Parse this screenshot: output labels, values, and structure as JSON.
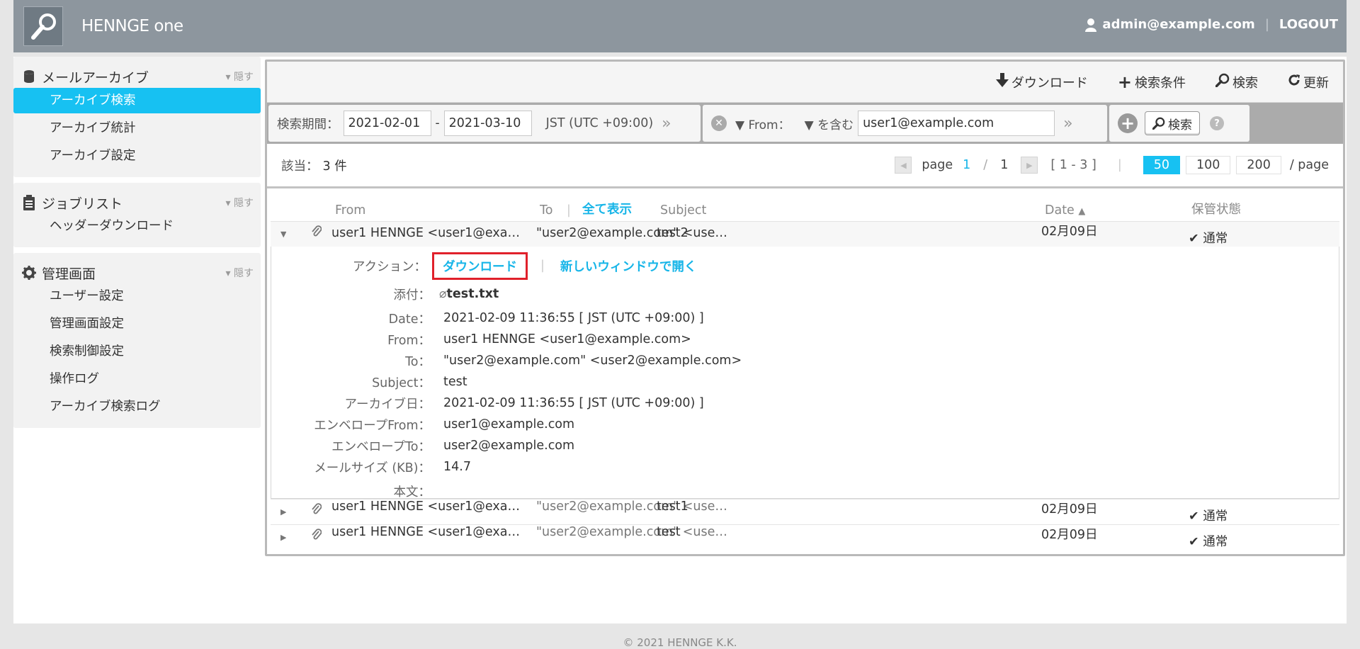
{
  "header": {
    "brand": "HENNGE one",
    "user": "admin@example.com",
    "logout": "LOGOUT"
  },
  "sidebar": {
    "sections": [
      {
        "title": "メールアーカイブ",
        "hide": "隠す",
        "items": [
          {
            "label": "アーカイブ検索",
            "active": true
          },
          {
            "label": "アーカイブ統計",
            "active": false
          },
          {
            "label": "アーカイブ設定",
            "active": false
          }
        ]
      },
      {
        "title": "ジョブリスト",
        "hide": "隠す",
        "items": [
          {
            "label": "ヘッダーダウンロード",
            "active": false
          }
        ]
      },
      {
        "title": "管理画面",
        "hide": "隠す",
        "items": [
          {
            "label": "ユーザー設定",
            "active": false
          },
          {
            "label": "管理画面設定",
            "active": false
          },
          {
            "label": "検索制御設定",
            "active": false
          },
          {
            "label": "操作ログ",
            "active": false
          },
          {
            "label": "アーカイブ検索ログ",
            "active": false
          }
        ]
      }
    ]
  },
  "toolbar": {
    "download": "ダウンロード",
    "conditions": "検索条件",
    "search": "検索",
    "refresh": "更新"
  },
  "search": {
    "period_label": "検索期間：",
    "date_from": "2021-02-01",
    "dash": "-",
    "date_to": "2021-03-10",
    "timezone": "JST (UTC +09:00)",
    "field": "From：",
    "operator": "を含む",
    "value": "user1@example.com",
    "search_button": "検索"
  },
  "results": {
    "count_label": "該当：",
    "count": "3 件",
    "page_label": "page",
    "page_current": "1",
    "page_slash": "/",
    "page_total": "1",
    "range": "[ 1 - 3 ]",
    "per_page": [
      "50",
      "100",
      "200"
    ],
    "per_page_selected": "50",
    "per_page_suffix": "/  page"
  },
  "table": {
    "headers": {
      "from": "From",
      "to": "To",
      "show_all": "全て表示",
      "subject": "Subject",
      "date": "Date",
      "status": "保管状態"
    },
    "rows": [
      {
        "from": "user1 HENNGE <user1@example.com>",
        "to": "\"user2@example.com\" <user2@example.com>",
        "subject": "test2",
        "date": "02月09日",
        "status": "通常",
        "open": true
      },
      {
        "from": "user1 HENNGE <user1@example.com>",
        "to": "\"user2@example.com\" <user2@example.com>",
        "subject": "test1",
        "date": "02月09日",
        "status": "通常",
        "open": false
      },
      {
        "from": "user1 HENNGE <user1@example.com>",
        "to": "\"user2@example.com\" <user2@example.com>",
        "subject": "test",
        "date": "02月09日",
        "status": "通常",
        "open": false
      }
    ]
  },
  "detail": {
    "action_label": "アクション：",
    "download": "ダウンロード",
    "separator": "|",
    "open_window": "新しいウィンドウで開く",
    "attach_label": "添付：",
    "attachment": "test.txt",
    "fields": [
      {
        "label": "Date：",
        "value": "2021-02-09 11:36:55 [ JST (UTC +09:00) ]"
      },
      {
        "label": "From：",
        "value": "user1 HENNGE <user1@example.com>"
      },
      {
        "label": "To：",
        "value": "\"user2@example.com\" <user2@example.com>"
      },
      {
        "label": "Subject：",
        "value": "test"
      },
      {
        "label": "アーカイブ日：",
        "value": "2021-02-09 11:36:55 [ JST (UTC +09:00) ]"
      },
      {
        "label": "エンベロープFrom：",
        "value": "user1@example.com"
      },
      {
        "label": "エンベロープTo：",
        "value": "user2@example.com"
      },
      {
        "label": "メールサイズ (KB)：",
        "value": "14.7"
      },
      {
        "label": "本文：",
        "value": ""
      }
    ]
  },
  "footer": "© 2021 HENNGE K.K."
}
